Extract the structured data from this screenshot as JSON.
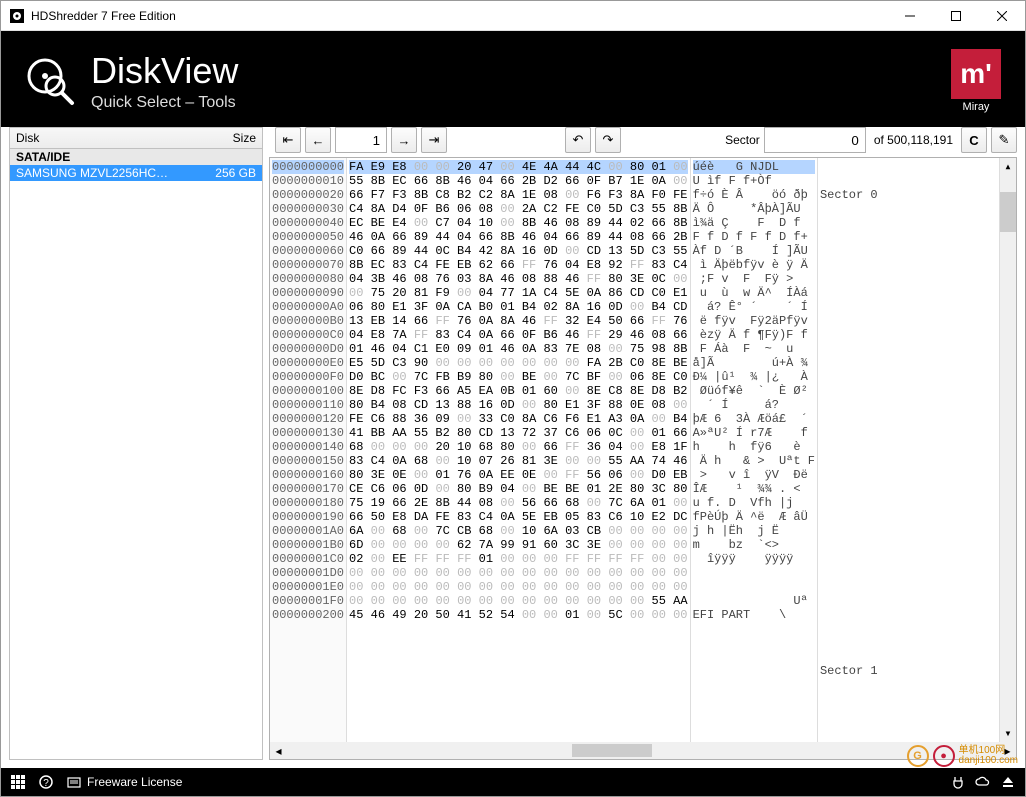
{
  "titlebar": {
    "text": "HDShredder 7 Free Edition"
  },
  "header": {
    "title": "DiskView",
    "subtitle": "Quick Select – Tools"
  },
  "logo": {
    "brand": "Miray",
    "mark": "m'"
  },
  "disk": {
    "headers": {
      "disk": "Disk",
      "size": "Size"
    },
    "group": "SATA/IDE",
    "items": [
      {
        "name": "SAMSUNG MZVL2256HC…",
        "size": "256 GB"
      }
    ]
  },
  "nav": {
    "page_input": "1",
    "sector_label": "Sector",
    "sector_input": "0",
    "of_text": "of 500,118,191"
  },
  "hex": {
    "sector0": "Sector 0",
    "sector1": "Sector 1",
    "rows": [
      {
        "o": "0000000000",
        "d": "FA E9 E8 00 00 20 47 00 4E 4A 44 4C 00 80 01 00",
        "a": "úéè   G NJDL    "
      },
      {
        "o": "0000000010",
        "d": "55 8B EC 66 8B 46 04 66 2B D2 66 0F B7 1E 0A 00",
        "a": "U ìf F f+Òf     "
      },
      {
        "o": "0000000020",
        "d": "66 F7 F3 8B C8 B2 C2 8A 1E 08 00 F6 F3 8A F0 FE",
        "a": "f÷ó È Â    öó ðþ"
      },
      {
        "o": "0000000030",
        "d": "C4 8A D4 0F B6 06 08 00 2A C2 FE C0 5D C3 55 8B",
        "a": "Ä Ô     *ÂþÀ]ÃU "
      },
      {
        "o": "0000000040",
        "d": "EC BE E4 00 C7 04 10 00 8B 46 08 89 44 02 66 8B",
        "a": "ì¾ä Ç    F  D f "
      },
      {
        "o": "0000000050",
        "d": "46 0A 66 89 44 04 66 8B 46 04 66 89 44 08 66 2B",
        "a": "F f D f F f D f+"
      },
      {
        "o": "0000000060",
        "d": "C0 66 89 44 0C B4 42 8A 16 0D 00 CD 13 5D C3 55",
        "a": "Àf D ´B    Í ]ÃU"
      },
      {
        "o": "0000000070",
        "d": "8B EC 83 C4 FE EB 62 66 FF 76 04 E8 92 FF 83 C4",
        "a": " ì Äþëbfÿv è ÿ Ä"
      },
      {
        "o": "0000000080",
        "d": "04 3B 46 08 76 03 8A 46 08 88 46 FF 80 3E 0C 00",
        "a": " ;F v  F  Fÿ >  "
      },
      {
        "o": "0000000090",
        "d": "00 75 20 81 F9 00 04 77 1A C4 5E 0A 86 CD C0 E1",
        "a": " u  ù  w Ä^  ÍÀá"
      },
      {
        "o": "00000000A0",
        "d": "06 80 E1 3F 0A CA B0 01 B4 02 8A 16 0D 00 B4 CD",
        "a": "  á? Ê° ´    ´ Í"
      },
      {
        "o": "00000000B0",
        "d": "13 EB 14 66 FF 76 0A 8A 46 FF 32 E4 50 66 FF 76",
        "a": " ë fÿv  Fÿ2äPfÿv"
      },
      {
        "o": "00000000C0",
        "d": "04 E8 7A FF 83 C4 0A 66 0F B6 46 FF 29 46 08 66",
        "a": " èzÿ Ä f ¶Fÿ)F f"
      },
      {
        "o": "00000000D0",
        "d": "01 46 04 C1 E0 09 01 46 0A 83 7E 08 00 75 98 8B",
        "a": " F Áà  F  ~  u  "
      },
      {
        "o": "00000000E0",
        "d": "E5 5D C3 90 00 00 00 00 00 00 00 FA 2B C0 8E BE",
        "a": "å]Ã        ú+À ¾"
      },
      {
        "o": "00000000F0",
        "d": "D0 BC 00 7C FB B9 80 00 BE 00 7C BF 00 06 8E C0",
        "a": "Ð¼ |û¹  ¾ |¿   À"
      },
      {
        "o": "0000000100",
        "d": "8E D8 FC F3 66 A5 EA 0B 01 60 00 8E C8 8E D8 B2",
        "a": " Øüóf¥ê  `  È Ø²"
      },
      {
        "o": "0000000110",
        "d": "80 B4 08 CD 13 88 16 0D 00 80 E1 3F 88 0E 08 00",
        "a": "  ´ Í     á?    "
      },
      {
        "o": "0000000120",
        "d": "FE C6 88 36 09 00 33 C0 8A C6 F6 E1 A3 0A 00 B4",
        "a": "þÆ 6  3À Æöá£  ´"
      },
      {
        "o": "0000000130",
        "d": "41 BB AA 55 B2 80 CD 13 72 37 C6 06 0C 00 01 66",
        "a": "A»ªU² Í r7Æ    f"
      },
      {
        "o": "0000000140",
        "d": "68 00 00 00 20 10 68 80 00 66 FF 36 04 00 E8 1F",
        "a": "h    h  fÿ6   è "
      },
      {
        "o": "0000000150",
        "d": "83 C4 0A 68 00 10 07 26 81 3E 00 00 55 AA 74 46",
        "a": " Ä h   & >  Uªt F"
      },
      {
        "o": "0000000160",
        "d": "80 3E 0E 00 01 76 0A EE 0E 00 FF 56 06 00 D0 EB",
        "a": " >   v î  ÿV  Ðë"
      },
      {
        "o": "0000000170",
        "d": "CE C6 06 0D 00 80 B9 04 00 BE BE 01 2E 80 3C 80",
        "a": "ÎÆ    ¹  ¾¾ . < "
      },
      {
        "o": "0000000180",
        "d": "75 19 66 2E 8B 44 08 00 56 66 68 00 7C 6A 01 00",
        "a": "u f. D  Vfh |j  "
      },
      {
        "o": "0000000190",
        "d": "66 50 E8 DA FE 83 C4 0A 5E EB 05 83 C6 10 E2 DC",
        "a": "fPèÚþ Ä ^ë  Æ âÜ"
      },
      {
        "o": "00000001A0",
        "d": "6A 00 68 00 7C CB 68 00 10 6A 03 CB 00 00 00 00",
        "a": "j h |Ëh  j Ë    "
      },
      {
        "o": "00000001B0",
        "d": "6D 00 00 00 00 62 7A 99 91 60 3C 3E 00 00 00 00",
        "a": "m    bz  `<>    "
      },
      {
        "o": "00000001C0",
        "d": "02 00 EE FF FF FF 01 00 00 00 FF FF FF FF 00 00",
        "a": "  îÿÿÿ    ÿÿÿÿ  "
      },
      {
        "o": "00000001D0",
        "d": "00 00 00 00 00 00 00 00 00 00 00 00 00 00 00 00",
        "a": "                "
      },
      {
        "o": "00000001E0",
        "d": "00 00 00 00 00 00 00 00 00 00 00 00 00 00 00 00",
        "a": "                "
      },
      {
        "o": "00000001F0",
        "d": "00 00 00 00 00 00 00 00 00 00 00 00 00 00 55 AA",
        "a": "              Uª"
      },
      {
        "o": "0000000200",
        "d": "45 46 49 20 50 41 52 54 00 00 01 00 5C 00 00 00",
        "a": "EFI PART    \\   "
      }
    ]
  },
  "statusbar": {
    "license": "Freeware License"
  },
  "watermark": {
    "t1": "单机100网",
    "t2": "danji100.com"
  }
}
